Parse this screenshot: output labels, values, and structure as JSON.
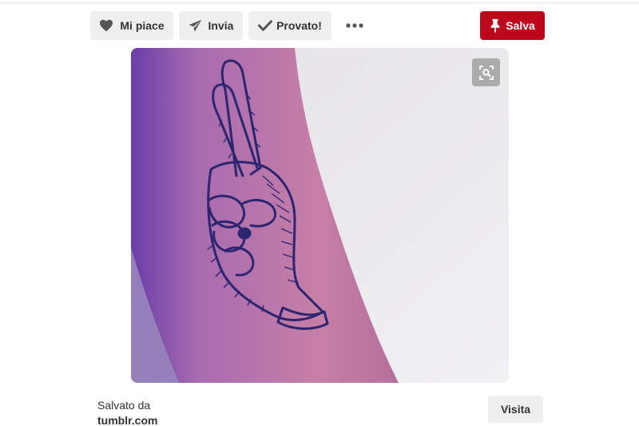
{
  "actions": {
    "like_label": "Mi piace",
    "send_label": "Invia",
    "tried_label": "Provato!",
    "save_label": "Salva"
  },
  "footer": {
    "saved_from_label": "Salvato da",
    "source": "tumblr.com",
    "visit_label": "Visita"
  },
  "icons": {
    "like": "heart-icon",
    "send": "paper-plane-icon",
    "tried": "checkmark-icon",
    "more": "more-dots-icon",
    "save": "pushpin-icon",
    "visual_search": "visual-search-icon"
  },
  "colors": {
    "save_button": "#bd081c",
    "button_gray": "#efefef",
    "text": "#333333"
  }
}
